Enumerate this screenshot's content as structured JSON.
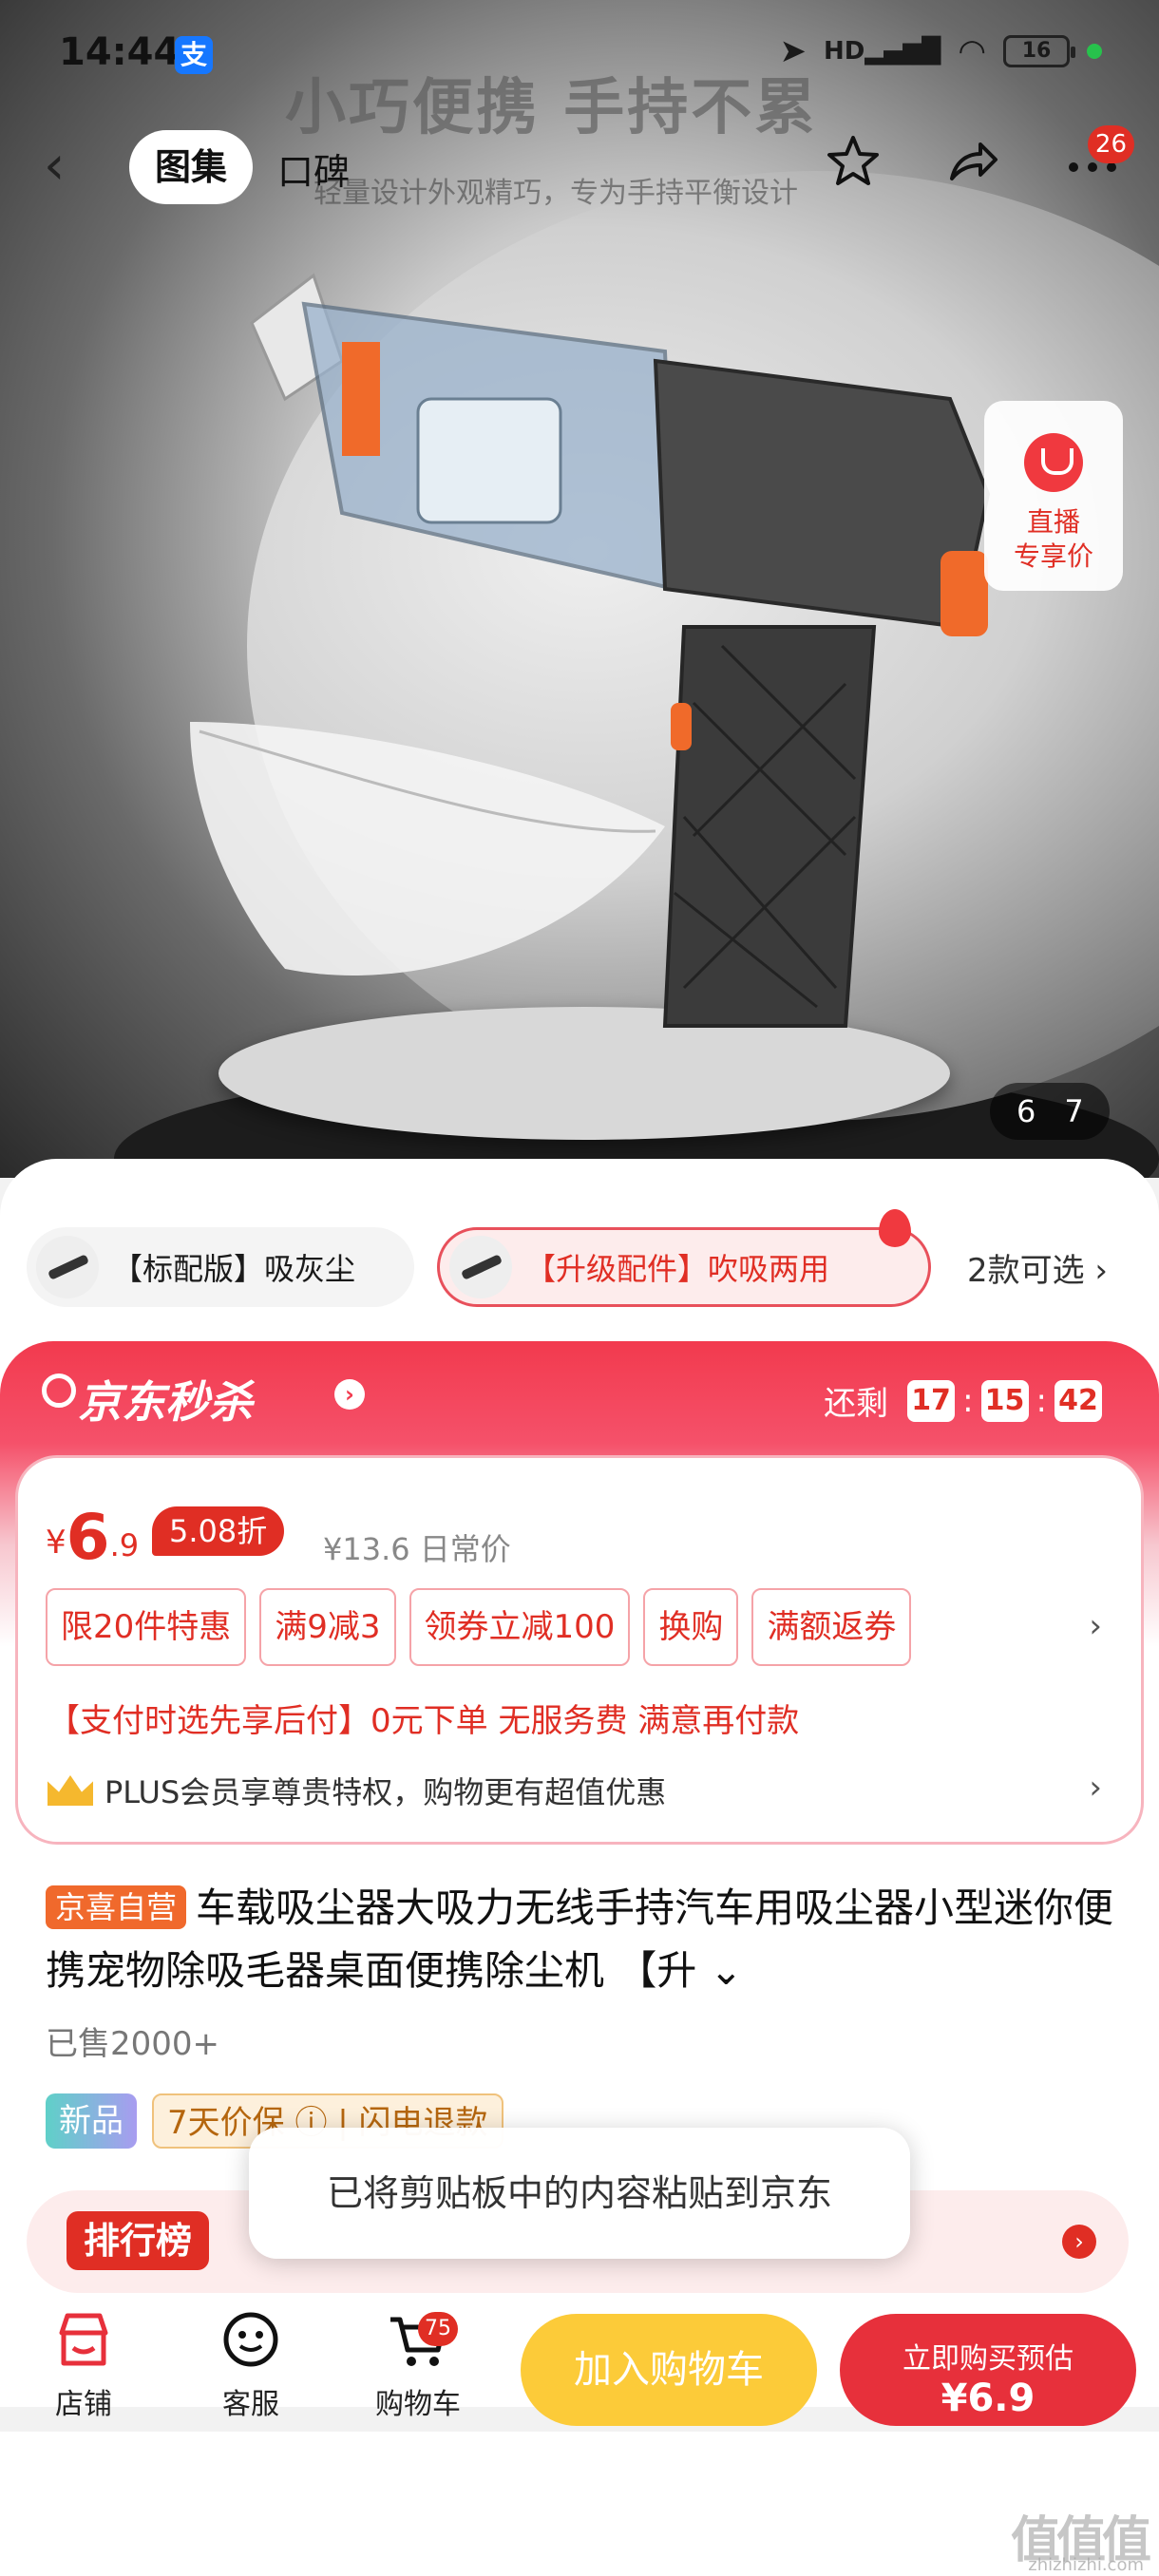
{
  "status": {
    "time": "14:44",
    "alipay": "支",
    "battery": "16",
    "net": "HD"
  },
  "hero": {
    "title": "小巧便携 手持不累",
    "subtitle": "轻量设计外观精巧，专为手持平衡设计",
    "image_index": "6",
    "image_total": "7"
  },
  "nav": {
    "tabs": [
      "图集",
      "口碑"
    ],
    "message_count": "26"
  },
  "live": {
    "line1": "直播",
    "line2": "专享价"
  },
  "sku": {
    "options": [
      "【标配版】吸灰尘",
      "【升级配件】吹吸两用"
    ],
    "more": "2款可选 ›"
  },
  "flash_sale": {
    "title": "京东秒杀",
    "remaining_label": "还剩",
    "hh": "17",
    "mm": "15",
    "ss": "42",
    "currency": "¥",
    "price_int": "6",
    "price_dec": ".9",
    "discount": "5.08折",
    "orig_price": "¥13.6 日常价",
    "tags": [
      "限20件特惠",
      "满9减3",
      "领券立减100",
      "换购",
      "满额返券"
    ],
    "pay_line": "【支付时选先享后付】0元下单 无服务费 满意再付款",
    "plus_line": "PLUS会员享尊贵特权，购物更有超值优惠"
  },
  "product": {
    "self_tag": "京喜自营",
    "title": "车载吸尘器大吸力无线手持汽车用吸尘器小型迷你便携宠物除吸毛器桌面便携除尘机 【升 ⌄",
    "sold": "已售2000+",
    "service_new": "新品",
    "service_guard": "7天价保 ⓘ | 闪电退款",
    "rank": "排行榜"
  },
  "toast": "已将剪贴板中的内容粘贴到京东",
  "bottom": {
    "shop": "店铺",
    "service": "客服",
    "cart": "购物车",
    "cart_count": "75",
    "add_cart": "加入购物车",
    "buy_line1": "立即购买预估",
    "buy_line2": "¥6.9"
  },
  "watermark": {
    "main": "值值值",
    "sub": "zhizhizhi.com"
  }
}
